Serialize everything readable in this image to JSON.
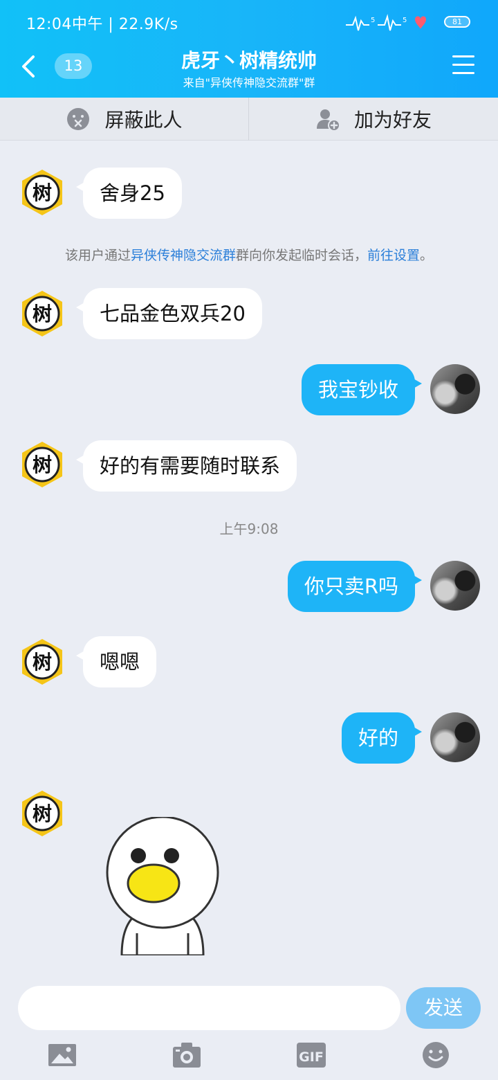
{
  "status": {
    "time": "12:04中午 | 22.9K/s",
    "battery": "81"
  },
  "header": {
    "badge": "13",
    "title": "虎牙丶树精统帅",
    "subtitle": "来自\"异侠传神隐交流群\"群"
  },
  "actions": {
    "block_label": "屏蔽此人",
    "add_friend_label": "加为好友"
  },
  "contact": {
    "avatar_char": "树"
  },
  "messages": [
    {
      "side": "in",
      "text": "舍身25"
    },
    {
      "side": "in",
      "text": "七品金色双兵20"
    },
    {
      "side": "out",
      "text": "我宝钞收"
    },
    {
      "side": "in",
      "text": "好的有需要随时联系"
    },
    {
      "side": "out",
      "text": "你只卖R吗"
    },
    {
      "side": "in",
      "text": "嗯嗯"
    },
    {
      "side": "out",
      "text": "好的"
    },
    {
      "side": "in",
      "type": "sticker",
      "icon": "duck-sticker"
    }
  ],
  "system_note": {
    "prefix": "该用户通过",
    "group_link": "异侠传神隐交流群",
    "middle": "群向你发起临时会话，",
    "settings_link": "前往设置",
    "suffix": "。"
  },
  "timestamp": "上午9:08",
  "input": {
    "value": "",
    "send_label": "发送"
  },
  "toolbar": {
    "gif_label": "GIF"
  },
  "colors": {
    "header_gradient_start": "#11c1f8",
    "header_gradient_end": "#10a7fb",
    "outgoing_bubble": "#1eb4f7",
    "incoming_bubble": "#ffffff",
    "send_button": "#7ec6f5",
    "background": "#eaedf4",
    "avatar_yellow": "#f5c518",
    "link": "#2b7fd9"
  }
}
